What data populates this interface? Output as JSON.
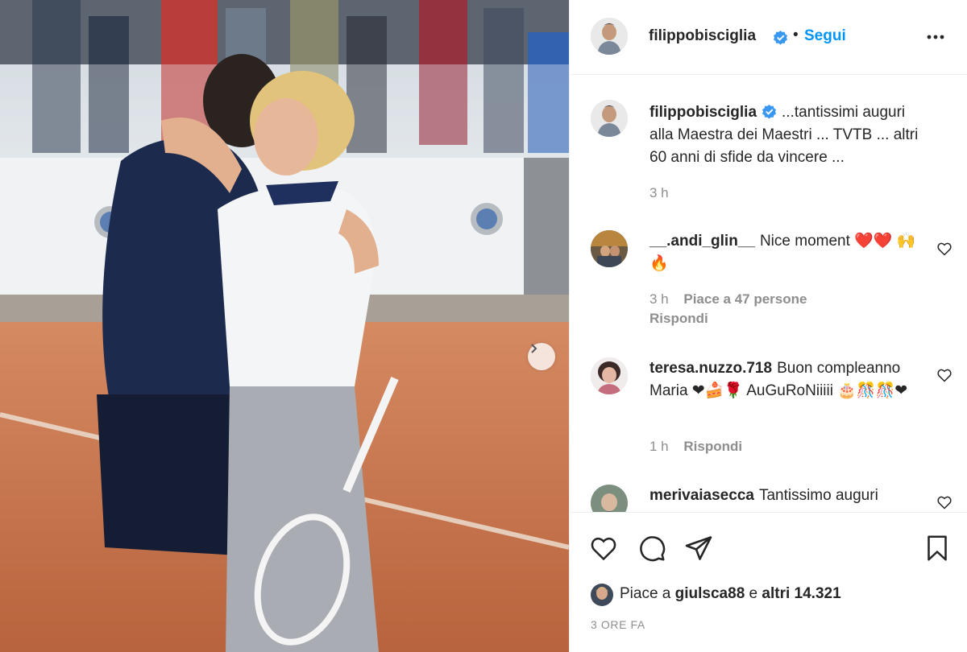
{
  "post": {
    "author": "filippobisciglia",
    "follow_label": "Segui",
    "separator": "•",
    "caption_author": "filippobisciglia",
    "caption": "...tantissimi auguri alla Maestra dei Maestri ... TVTB ... altri 60 anni di sfide da vincere ...",
    "caption_time": "3 h"
  },
  "comments": [
    {
      "user": "__.andi_glin__",
      "text": "Nice moment ❤️❤️ 🙌🔥",
      "time": "3 h",
      "likes": "Piace a 47 persone",
      "reply": "Rispondi"
    },
    {
      "user": "teresa.nuzzo.718",
      "text": "Buon compleanno Maria ❤🍰🌹 AuGuRoNiiiii 🎂🎊🎊❤",
      "time": "1 h",
      "reply": "Rispondi"
    },
    {
      "user": "merivaiasecca",
      "text": "Tantissimo auguri"
    }
  ],
  "likes_summary": {
    "prefix": "Piace a",
    "user": "giulsca88",
    "middle": "e",
    "others": "altri 14.321"
  },
  "timestamp": "3 ORE FA",
  "icons": {
    "verified": "verified-badge-icon",
    "more": "more-options-icon",
    "like": "heart-icon",
    "comment": "comment-bubble-icon",
    "share": "paper-plane-icon",
    "save": "bookmark-icon",
    "next": "chevron-right-icon"
  },
  "colors": {
    "accent": "#0095f6",
    "text": "#262626",
    "muted": "#8e8e8e",
    "like_heart": "#ed4956"
  }
}
